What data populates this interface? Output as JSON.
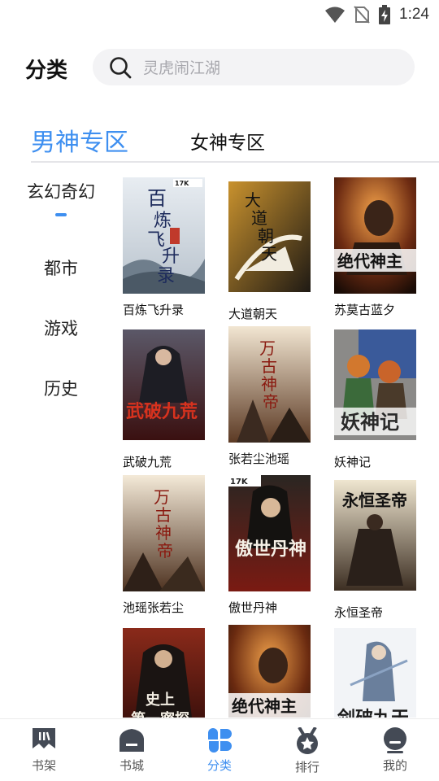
{
  "status_bar": {
    "time": "1:24",
    "icons": [
      "wifi-icon",
      "no-sim-icon",
      "battery-charging-icon"
    ]
  },
  "header": {
    "title": "分类",
    "search": {
      "placeholder": "灵虎闹江湖",
      "icon": "search-icon"
    }
  },
  "gender_tabs": [
    {
      "label": "男神专区",
      "active": true
    },
    {
      "label": "女神专区",
      "active": false
    }
  ],
  "categories": [
    {
      "label": "玄幻奇幻",
      "active": true
    },
    {
      "label": "都市",
      "active": false
    },
    {
      "label": "游戏",
      "active": false
    },
    {
      "label": "历史",
      "active": false
    }
  ],
  "books": [
    {
      "title": "百炼飞升录",
      "cover_text": "百炼飞升录",
      "badge": "17K"
    },
    {
      "title": "大道朝天",
      "cover_text": "大道朝天",
      "badge": ""
    },
    {
      "title": "苏莫古蓝夕",
      "cover_text": "绝代神主",
      "badge": ""
    },
    {
      "title": "武破九荒",
      "cover_text": "武破九荒",
      "badge": ""
    },
    {
      "title": "张若尘池瑶",
      "cover_text": "万古神帝",
      "badge": ""
    },
    {
      "title": "妖神记",
      "cover_text": "妖神记",
      "badge": ""
    },
    {
      "title": "池瑶张若尘",
      "cover_text": "万古神帝",
      "badge": ""
    },
    {
      "title": "傲世丹神",
      "cover_text": "傲世丹神",
      "badge": "17K"
    },
    {
      "title": "永恒圣帝",
      "cover_text": "永恒圣帝",
      "badge": ""
    },
    {
      "title": "",
      "cover_text": "史上第一密探",
      "badge": ""
    },
    {
      "title": "",
      "cover_text": "绝代神主",
      "badge": ""
    },
    {
      "title": "",
      "cover_text": "剑破九天",
      "badge": ""
    }
  ],
  "bottom_nav": [
    {
      "label": "书架",
      "icon": "bookshelf-icon",
      "active": false
    },
    {
      "label": "书城",
      "icon": "bookstore-icon",
      "active": false
    },
    {
      "label": "分类",
      "icon": "category-icon",
      "active": true
    },
    {
      "label": "排行",
      "icon": "ranking-medal-icon",
      "active": false
    },
    {
      "label": "我的",
      "icon": "profile-icon",
      "active": false
    }
  ],
  "colors": {
    "accent": "#3e8ff0",
    "nav_inactive": "#444a55",
    "search_bg": "#f3f3f5"
  }
}
